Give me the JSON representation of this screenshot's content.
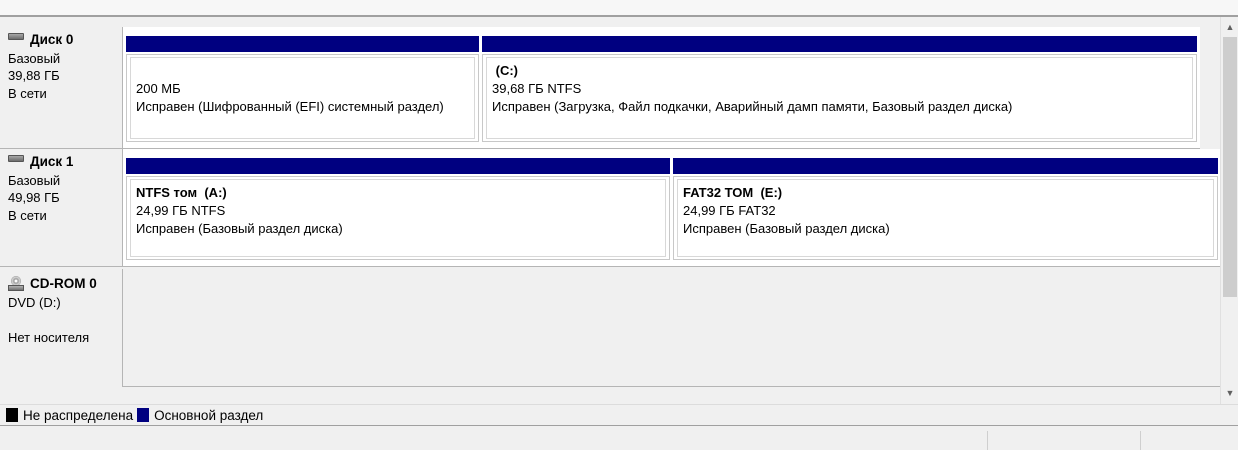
{
  "disks": [
    {
      "title": "Диск 0",
      "icon": "hard-drive-icon",
      "type": "Базовый",
      "size": "39,88 ГБ",
      "status": "В сети",
      "partitions": [
        {
          "name": "",
          "size": "200 МБ",
          "status": "Исправен (Шифрованный (EFI) системный раздел)"
        },
        {
          "name": " (C:)",
          "size": "39,68 ГБ NTFS",
          "status": "Исправен (Загрузка, Файл подкачки, Аварийный дамп памяти, Базовый раздел диска)"
        }
      ]
    },
    {
      "title": "Диск 1",
      "icon": "hard-drive-icon",
      "type": "Базовый",
      "size": "49,98 ГБ",
      "status": "В сети",
      "partitions": [
        {
          "name": "NTFS том  (A:)",
          "size": "24,99 ГБ NTFS",
          "status": "Исправен (Базовый раздел диска)"
        },
        {
          "name": "FAT32 ТОМ  (E:)",
          "size": "24,99 ГБ FAT32",
          "status": "Исправен (Базовый раздел диска)"
        }
      ]
    }
  ],
  "cdrom": {
    "title": "CD-ROM 0",
    "icon": "cd-drive-icon",
    "type": "DVD (D:)",
    "media": "Нет носителя"
  },
  "legend": [
    {
      "label": "Не распределена",
      "color": "#000000"
    },
    {
      "label": "Основной раздел",
      "color": "#000080"
    }
  ],
  "colors": {
    "primary_partition_header": "#000080",
    "unallocated": "#000000"
  }
}
